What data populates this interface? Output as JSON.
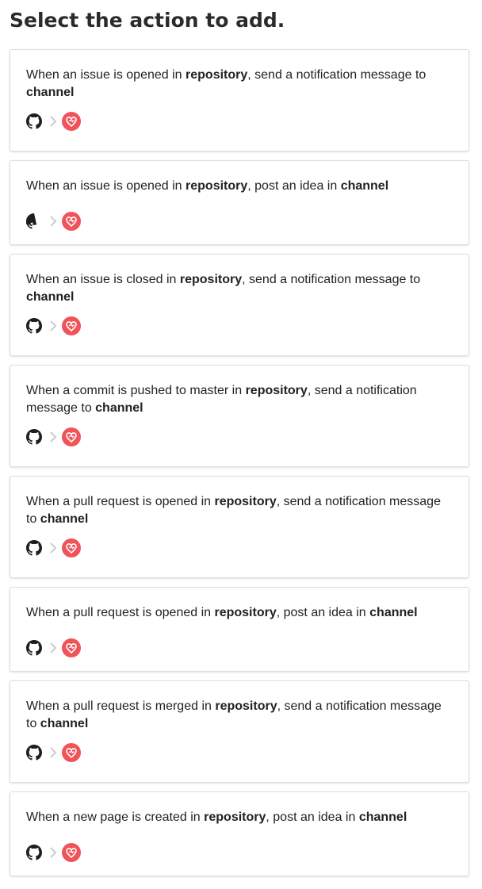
{
  "page_title": "Select the action to add.",
  "colors": {
    "accent": "#f1535a",
    "chevron": "#cccccc",
    "github": "#1b1f23"
  },
  "icons": {
    "source": "github-icon",
    "separator": "chevron-right-icon",
    "target": "heart-icon"
  },
  "actions": [
    {
      "pre": "When an issue is opened in ",
      "repo": "repository",
      "mid": ", send a notification message to ",
      "chan": "channel"
    },
    {
      "pre": "When an issue is opened in ",
      "repo": "repository",
      "mid": ", post an idea in ",
      "chan": "channel"
    },
    {
      "pre": "When an issue is closed in ",
      "repo": "repository",
      "mid": ", send a notification message to ",
      "chan": "channel"
    },
    {
      "pre": "When a commit is pushed to master in ",
      "repo": "repository",
      "mid": ", send a notification message to ",
      "chan": "channel"
    },
    {
      "pre": "When a pull request is opened in ",
      "repo": "repository",
      "mid": ", send a notification message to ",
      "chan": "channel"
    },
    {
      "pre": "When a pull request is opened in ",
      "repo": "repository",
      "mid": ", post an idea in ",
      "chan": "channel"
    },
    {
      "pre": "When a pull request is merged in ",
      "repo": "repository",
      "mid": ", send a notification message to ",
      "chan": "channel"
    },
    {
      "pre": "When a new page is created in ",
      "repo": "repository",
      "mid": ", post an idea in ",
      "chan": "channel"
    }
  ]
}
